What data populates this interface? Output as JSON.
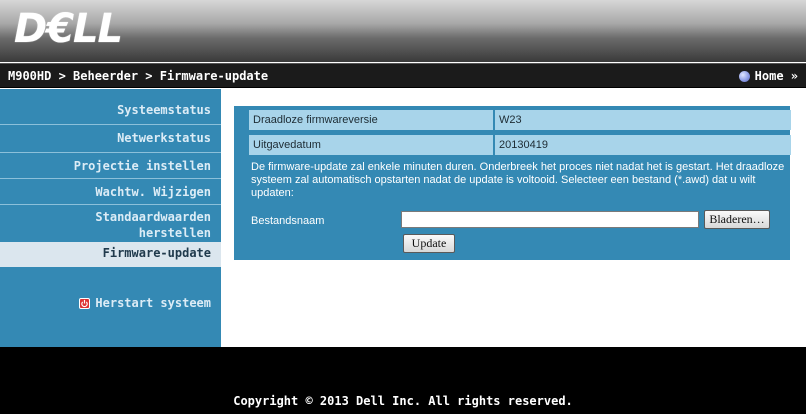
{
  "header": {
    "logo_text": "D€LL"
  },
  "breadcrumb": {
    "path": "M900HD > Beheerder > Firmware-update",
    "home_label": "Home »"
  },
  "sidebar": {
    "items": [
      {
        "label": "Systeemstatus"
      },
      {
        "label": "Netwerkstatus"
      },
      {
        "label": "Projectie instellen"
      },
      {
        "label": "Wachtw. Wijzigen"
      },
      {
        "label_line1": "Standaardwaarden",
        "label_line2": "herstellen"
      },
      {
        "label": "Firmware-update",
        "active": true
      }
    ],
    "restart_label": "Herstart systeem"
  },
  "firmware": {
    "version_label": "Draadloze firmwareversie",
    "version_value": "W23",
    "date_label": "Uitgavedatum",
    "date_value": "20130419",
    "info_text": "De firmware-update zal enkele minuten duren. Onderbreek het proces niet nadat het is gestart. Het draadloze systeem zal automatisch opstarten nadat de update is voltooid. Selecteer een bestand (*.awd) dat u wilt updaten:",
    "filename_label": "Bestandsnaam",
    "filename_value": "",
    "browse_label": "Bladeren…",
    "update_label": "Update"
  },
  "footer": {
    "copyright": "Copyright © 2013 Dell Inc. All rights reserved."
  },
  "colors": {
    "sidebar_bg": "#3489b4",
    "panel_cell_bg": "#a8d4ea",
    "active_item_bg": "#dbe6ee",
    "footer_bg": "#000000"
  },
  "icons": {
    "home": "home-dot-icon",
    "restart": "power-icon"
  }
}
